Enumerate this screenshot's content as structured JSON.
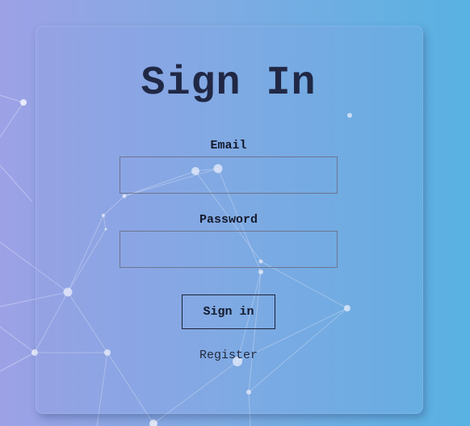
{
  "form": {
    "title": "Sign In",
    "email_label": "Email",
    "email_value": "",
    "password_label": "Password",
    "password_value": "",
    "submit_label": "Sign in",
    "register_label": "Register"
  },
  "icons": {
    "background": "network-particles-icon"
  },
  "colors": {
    "background_gradient_start": "#9da1e6",
    "background_gradient_end": "#58b2e2",
    "text_dark": "#202845"
  }
}
